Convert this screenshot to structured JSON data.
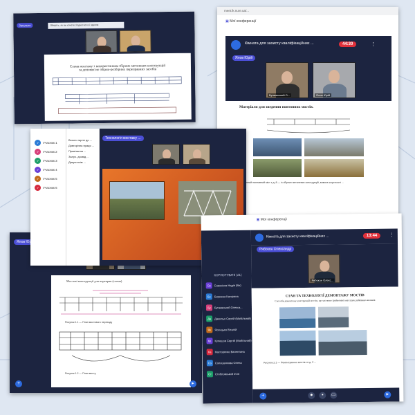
{
  "card1": {
    "tab_label": "Загальне",
    "notice": "Оберіть, як ви хочете з'єднатися зі звуком",
    "doc_title_line1": "Схема монтажу з використанням збірних металевих конструкцій",
    "doc_title_line2": "за допомогою збірно-розбірних переправних засобів"
  },
  "card2": {
    "url": "meet.lk.nure.ua/...",
    "room_title": "Кімната для захисту кваліфікаційних ...",
    "timer": "44:30",
    "presenter": "Ялов Юрій",
    "my_conferences": "Мої конференції",
    "video1_label": "Бугаєвський О...",
    "video2_label": "Ялов Юрій",
    "material_title": "Матеріали для зведення понтонних мостів.",
    "caption": "Понтонний наплавний міст з д. 8 — із збірних металевих конструкцій, вимога жорсткості ..."
  },
  "card3": {
    "chat": [
      "Всього гарне до ...",
      "Довгорічна праця ...",
      "Привітання ...",
      "Залуч. досвід ...",
      "Дякую всім ..."
    ],
    "participants": [
      "Учасник 1",
      "Учасник 2",
      "Учасник 3",
      "Учасник 4",
      "Учасник 5",
      "Учасник 6"
    ],
    "slide_header": "Технологія монтажу ..."
  },
  "card4": {
    "presenter": "Ялов Юрій",
    "doc_title": "Мостові конструкції для переправ (схема)",
    "fig1": "Рисунок 1.1 — План мостового переходу",
    "fig2": "Рисунок 1.2 — План мосту"
  },
  "card5": {
    "my_conferences": "Мої конференції",
    "room_title": "Кімната для захисту кваліфікаційних ...",
    "timer": "13:44",
    "presenter": "Рябокон Олександр",
    "video_label": "Рябокон Олекс...",
    "users_header": "КОРИСТУВАЧІ (21)",
    "users": [
      {
        "initials": "Св",
        "name": "Савоніков Надія (Ви)",
        "color": "#6a3fd6"
      },
      {
        "initials": "Бе",
        "name": "Бережна Катерина",
        "color": "#2a7bd6"
      },
      {
        "initials": "Бу",
        "name": "Бугаєвський Олекса...",
        "color": "#d63f7a"
      },
      {
        "initials": "Да",
        "name": "Данильо Сергій (Мобільний)",
        "color": "#1d9e6a"
      },
      {
        "initials": "Як",
        "name": "Ясенцько Віталій",
        "color": "#c26a1a"
      },
      {
        "initials": "Кр",
        "name": "Кулешов Сергій (Мобільний)",
        "color": "#6a3fd6"
      },
      {
        "initials": "Ка",
        "name": "Насторенко Валентина",
        "color": "#d6283c"
      },
      {
        "initials": "Со",
        "name": "Солошенкова Олена",
        "color": "#2a7bd6"
      },
      {
        "initials": "Ст",
        "name": "Стебловський Ілля",
        "color": "#1d9e6a"
      }
    ],
    "doc_title": "СТАН ТА ТЕХНОЛОГІЇ ДЕМОНТАЖУ МОСТІВ",
    "doc_sub": "Способи демонтажу конструкцій мостів, що частково зруйновані внаслідок руйнівних впливів",
    "caption": "Рисунок 2.1 — Ремонтування мостів та д. 2 ..."
  }
}
